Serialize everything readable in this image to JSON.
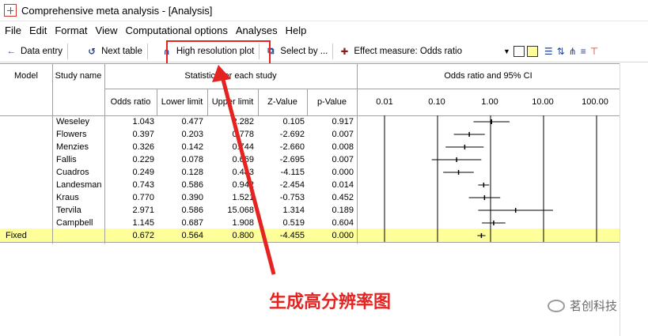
{
  "window": {
    "title": "Comprehensive meta analysis - [Analysis]"
  },
  "menu": [
    "File",
    "Edit",
    "Format",
    "View",
    "Computational options",
    "Analyses",
    "Help"
  ],
  "toolbar": {
    "data_entry": "Data entry",
    "next_table": "Next table",
    "high_res": "High resolution plot",
    "select_by": "Select by ...",
    "effect_measure": "Effect measure:  Odds ratio"
  },
  "grid": {
    "headers": {
      "model": "Model",
      "study_name": "Study name",
      "stats_group": "Statistics for each study",
      "plot_group": "Odds ratio and 95% CI",
      "columns": [
        "Odds ratio",
        "Lower limit",
        "Upper limit",
        "Z-Value",
        "p-Value"
      ],
      "axis_ticks": [
        "0.01",
        "0.10",
        "1.00",
        "10.00",
        "100.00"
      ]
    },
    "rows": [
      {
        "study": "Weseley",
        "or": "1.043",
        "lower": "0.477",
        "upper": "2.282",
        "z": "0.105",
        "p": "0.917",
        "or_val": 1.043,
        "lo_val": 0.477,
        "hi_val": 2.282
      },
      {
        "study": "Flowers",
        "or": "0.397",
        "lower": "0.203",
        "upper": "0.778",
        "z": "-2.692",
        "p": "0.007",
        "or_val": 0.397,
        "lo_val": 0.203,
        "hi_val": 0.778
      },
      {
        "study": "Menzies",
        "or": "0.326",
        "lower": "0.142",
        "upper": "0.744",
        "z": "-2.660",
        "p": "0.008",
        "or_val": 0.326,
        "lo_val": 0.142,
        "hi_val": 0.744
      },
      {
        "study": "Fallis",
        "or": "0.229",
        "lower": "0.078",
        "upper": "0.669",
        "z": "-2.695",
        "p": "0.007",
        "or_val": 0.229,
        "lo_val": 0.078,
        "hi_val": 0.669
      },
      {
        "study": "Cuadros",
        "or": "0.249",
        "lower": "0.128",
        "upper": "0.483",
        "z": "-4.115",
        "p": "0.000",
        "or_val": 0.249,
        "lo_val": 0.128,
        "hi_val": 0.483
      },
      {
        "study": "Landesman",
        "or": "0.743",
        "lower": "0.586",
        "upper": "0.942",
        "z": "-2.454",
        "p": "0.014",
        "or_val": 0.743,
        "lo_val": 0.586,
        "hi_val": 0.942
      },
      {
        "study": "Kraus",
        "or": "0.770",
        "lower": "0.390",
        "upper": "1.521",
        "z": "-0.753",
        "p": "0.452",
        "or_val": 0.77,
        "lo_val": 0.39,
        "hi_val": 1.521
      },
      {
        "study": "Tervila",
        "or": "2.971",
        "lower": "0.586",
        "upper": "15.068",
        "z": "1.314",
        "p": "0.189",
        "or_val": 2.971,
        "lo_val": 0.586,
        "hi_val": 15.068
      },
      {
        "study": "Campbell",
        "or": "1.145",
        "lower": "0.687",
        "upper": "1.908",
        "z": "0.519",
        "p": "0.604",
        "or_val": 1.145,
        "lo_val": 0.687,
        "hi_val": 1.908
      }
    ],
    "fixed": {
      "model": "Fixed",
      "or": "0.672",
      "lower": "0.564",
      "upper": "0.800",
      "z": "-4.455",
      "p": "0.000",
      "or_val": 0.672,
      "lo_val": 0.564,
      "hi_val": 0.8
    }
  },
  "annotation": "生成高分辨率图",
  "watermark": "茗创科技",
  "colors": {
    "highlight": "#e52421",
    "fixed_row": "#ffff99",
    "effect_icon": "#8b1a1a"
  }
}
